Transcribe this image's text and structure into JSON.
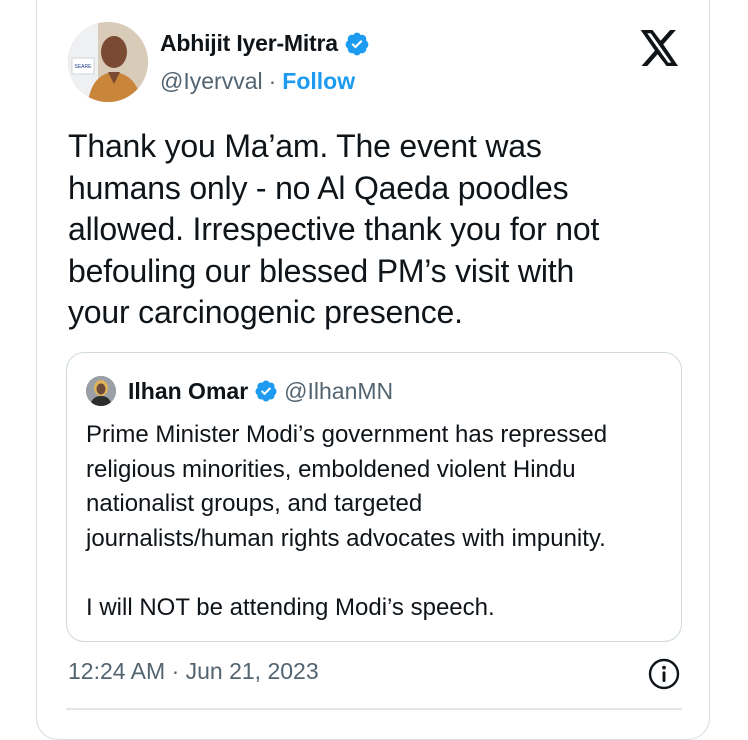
{
  "author": {
    "name": "Abhijit Iyer-Mitra",
    "handle": "@Iyervval",
    "separator": "·",
    "follow_label": "Follow",
    "avatar_sign_text": "SEARE"
  },
  "tweet": {
    "lines": [
      "Thank you Ma’am. The event was",
      "humans only - no Al Qaeda poodles",
      "allowed. Irrespective thank you for not",
      "befouling our blessed PM’s visit with",
      "your carcinogenic presence."
    ],
    "timestamp": "12:24 AM · Jun 21, 2023"
  },
  "quoted": {
    "name": "Ilhan Omar",
    "handle": "@IlhanMN",
    "paragraph1_lines": [
      "Prime Minister Modi’s government has repressed",
      "religious minorities, emboldened violent Hindu",
      "nationalist groups, and targeted",
      "journalists/human rights advocates with impunity."
    ],
    "paragraph2": "I will NOT be attending Modi’s speech."
  },
  "icons": {
    "verified": "verified-badge-icon",
    "platform": "x-logo-icon",
    "info": "info-icon"
  },
  "colors": {
    "accent": "#1d9bf0",
    "secondary_text": "#536471",
    "text": "#0f1419"
  }
}
